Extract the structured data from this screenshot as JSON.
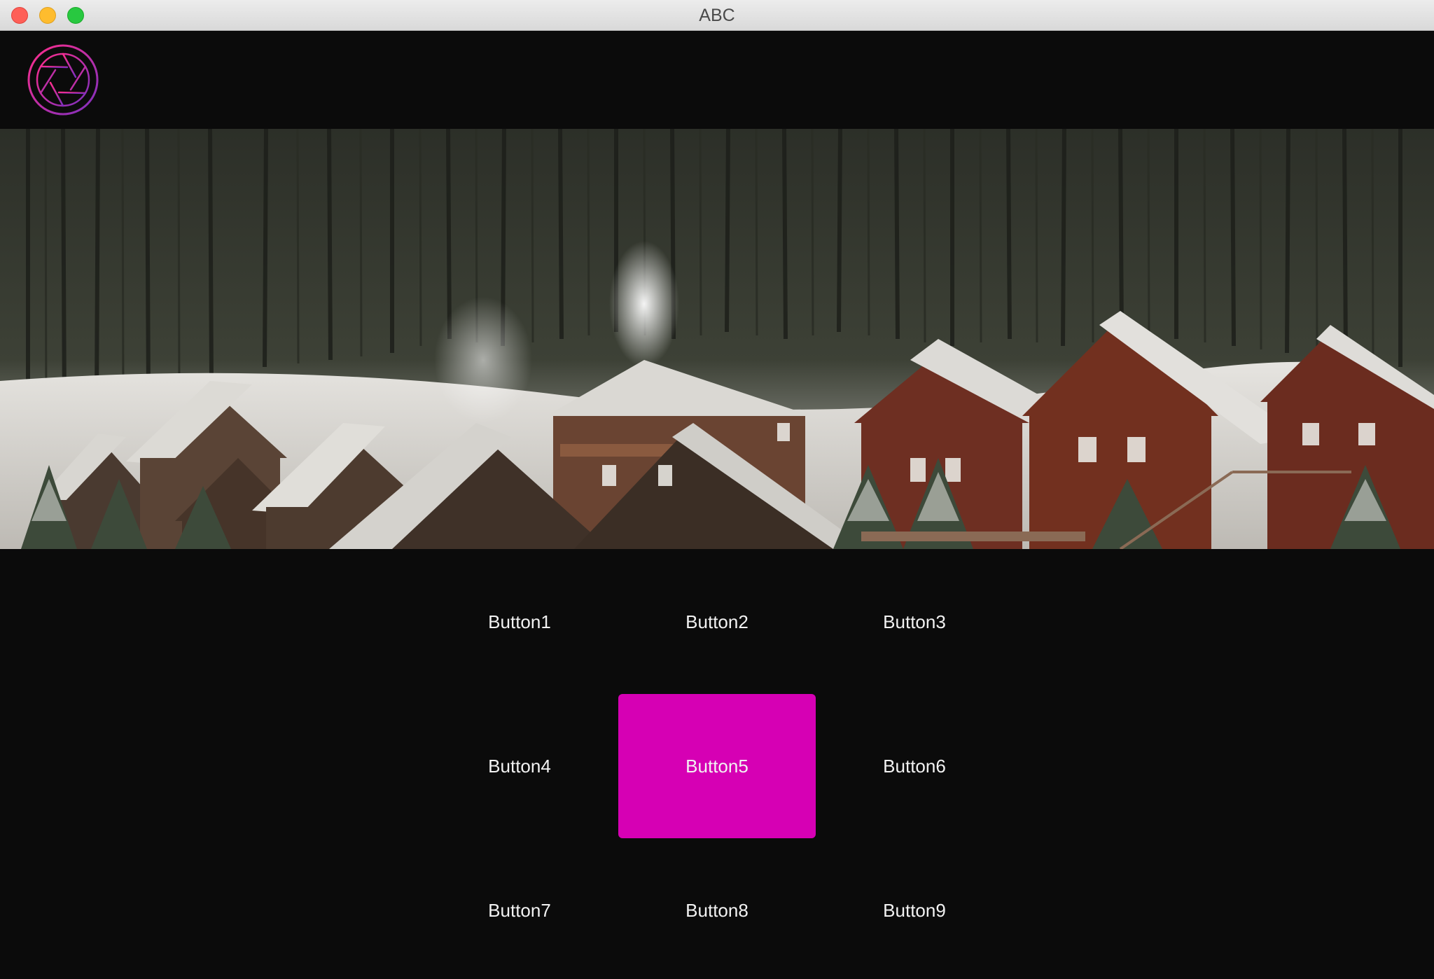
{
  "window": {
    "title": "ABC"
  },
  "header": {
    "logo_icon": "camera-aperture-icon"
  },
  "banner": {
    "image": "snowy-cabins-in-forest-photo"
  },
  "buttons": [
    {
      "label": "Button1",
      "active": false
    },
    {
      "label": "Button2",
      "active": false
    },
    {
      "label": "Button3",
      "active": false
    },
    {
      "label": "Button4",
      "active": false
    },
    {
      "label": "Button5",
      "active": true
    },
    {
      "label": "Button6",
      "active": false
    },
    {
      "label": "Button7",
      "active": false
    },
    {
      "label": "Button8",
      "active": false
    },
    {
      "label": "Button9",
      "active": false
    }
  ],
  "colors": {
    "background": "#0b0b0b",
    "accent": "#d600b4",
    "button_text": "#f2f2f2"
  }
}
